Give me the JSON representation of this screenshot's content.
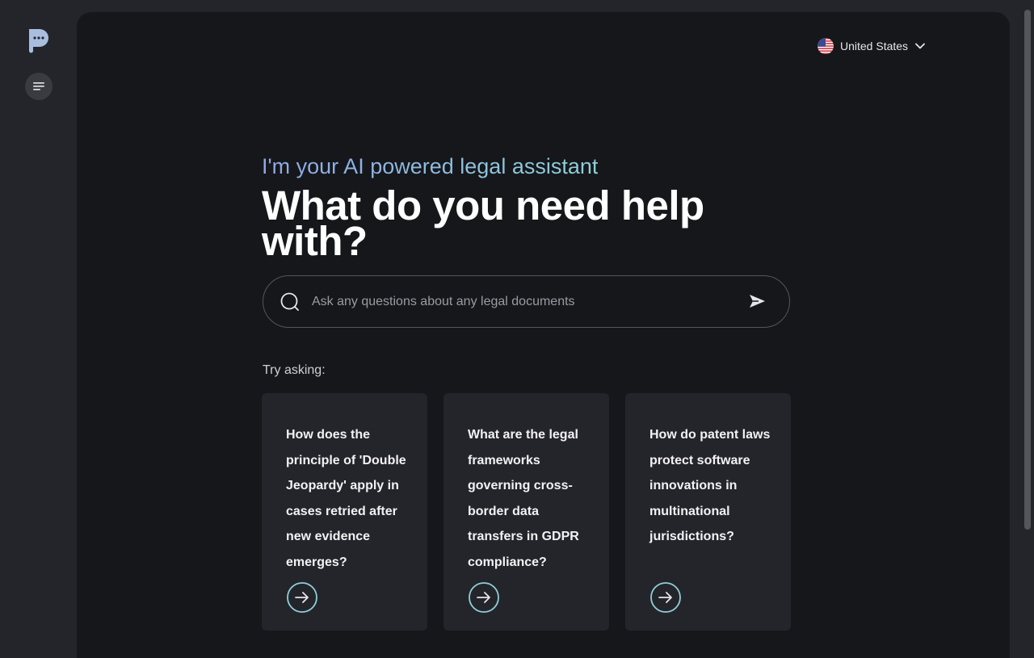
{
  "sidebar": {
    "logo_icon": "chat-bubble-logo-icon",
    "menu_icon": "menu-lines-icon"
  },
  "header": {
    "country": "United States",
    "country_icon": "us-flag-icon"
  },
  "hero": {
    "tagline": "I'm your AI powered legal assistant",
    "headline": "What do you need help with?"
  },
  "search": {
    "placeholder": "Ask any questions about any legal documents",
    "value": "",
    "search_icon": "search-icon",
    "send_icon": "send-icon"
  },
  "suggestions": {
    "label": "Try asking:",
    "items": [
      {
        "text": "How does the principle of 'Double Jeopardy' apply in cases retried after new evidence emerges?"
      },
      {
        "text": "What are the legal frameworks governing cross-border data transfers in GDPR compliance?"
      },
      {
        "text": "How do patent laws protect software innovations in multinational jurisdictions?"
      }
    ]
  },
  "colors": {
    "sidebar_bg": "#24252b",
    "main_bg": "#16171b",
    "card_bg": "#24252b",
    "accent_teal": "#8fd0d8",
    "accent_blue": "#8ea8e6"
  }
}
